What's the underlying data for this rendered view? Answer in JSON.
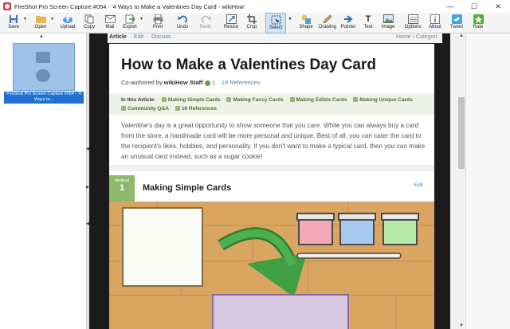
{
  "window": {
    "title": "FireShot Pro Screen Capture #054 - '4 Ways to Make a Valentines Day Card - wikiHow'",
    "minimize": "—",
    "maximize": "☐",
    "close": "✕"
  },
  "toolbar": {
    "save": "Save",
    "open": "Open",
    "upload": "Upload",
    "copy": "Copy",
    "mail": "Mail",
    "export": "Export",
    "print": "Print",
    "undo": "Undo",
    "redo": "Redo",
    "resize": "Resize",
    "crop": "Crop",
    "select": "Select",
    "shape": "Shape",
    "drawing": "Drawing",
    "pointer": "Pointer",
    "text": "Text",
    "image": "Image",
    "options": "Options",
    "about": "About",
    "tweet": "Tweet",
    "rate": "Rate"
  },
  "thumbnail": {
    "caption": "FireShot Pro Screen Capture #054 - '4 Ways to..."
  },
  "wiki": {
    "nav_article": "Article",
    "nav_edit": "Edit",
    "nav_discuss": "Discuss",
    "breadcrumb": "Home › Categori",
    "title": "How to Make a Valentines Day Card",
    "coauthored": "Co-authored by",
    "staff": "wikiHow Staff",
    "refs": "19 References",
    "in_this_article": "In this Article:",
    "sections": [
      "Making Simple Cards",
      "Making Fancy Cards",
      "Making Edible Cards",
      "Making Unique Cards",
      "Community Q&A",
      "19 References"
    ],
    "intro": "Valentine's day is a great opportunity to show someone that you care. While you can always buy a card from the store, a handmade card will be more personal and unique. Best of all, you can cater the card to the recipient's likes, hobbies, and personality. If you don't want to make a typical card, then you can make an unusual card instead, such as a sugar cookie!",
    "method_label": "Method",
    "method_number": "1",
    "method_title": "Making Simple Cards",
    "method_edit": "Edit"
  },
  "colors": {
    "accent_green": "#8eb86b",
    "link_blue": "#4a7db5",
    "selection_blue": "#1e71d3"
  }
}
